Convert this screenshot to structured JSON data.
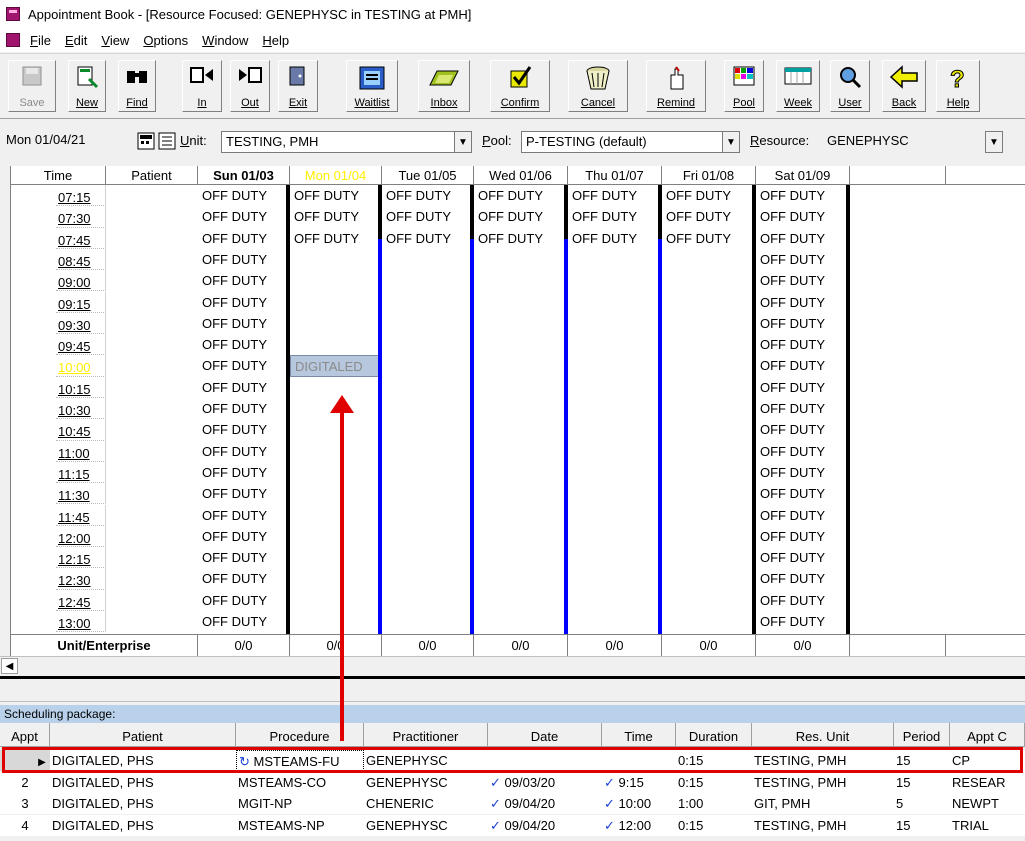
{
  "window": {
    "title": "Appointment Book - [Resource Focused:  GENEPHYSC in TESTING at PMH]"
  },
  "menu": [
    {
      "u": "F",
      "rest": "ile"
    },
    {
      "u": "E",
      "rest": "dit"
    },
    {
      "u": "V",
      "rest": "iew"
    },
    {
      "u": "O",
      "rest": "ptions"
    },
    {
      "u": "W",
      "rest": "indow"
    },
    {
      "u": "H",
      "rest": "elp"
    }
  ],
  "toolbar": {
    "save": "Save",
    "new": "New",
    "find": "Find",
    "in": "In",
    "out": "Out",
    "exit": "Exit",
    "waitlist": "Waitlist",
    "inbox": "Inbox",
    "confirm": "Confirm",
    "cancel": "Cancel",
    "remind": "Remind",
    "pool": "Pool",
    "week": "Week",
    "user": "User",
    "back": "Back",
    "help": "Help"
  },
  "filters": {
    "date": "Mon 01/04/21",
    "unit_label_u": "U",
    "unit_label_rest": "nit:",
    "unit_value": "TESTING, PMH",
    "pool_label_u": "P",
    "pool_label_rest": "ool:",
    "pool_value": "P-TESTING (default)",
    "resource_label_u": "R",
    "resource_label_rest": "esource:",
    "resource_value": "GENEPHYSC"
  },
  "grid": {
    "headers": {
      "time": "Time",
      "patient": "Patient",
      "sun": "Sun 01/03",
      "mon": "Mon 01/04",
      "tue": "Tue 01/05",
      "wed": "Wed 01/06",
      "thu": "Thu 01/07",
      "fri": "Fri 01/08",
      "sat": "Sat 01/09"
    },
    "off_duty": "OFF DUTY",
    "times": [
      "07:15",
      "07:30",
      "07:45",
      "08:45",
      "09:00",
      "09:15",
      "09:30",
      "09:45",
      "10:00",
      "10:15",
      "10:30",
      "10:45",
      "11:00",
      "11:15",
      "11:30",
      "11:45",
      "12:00",
      "12:15",
      "12:30",
      "12:45",
      "13:00"
    ],
    "selected_time": "10:00",
    "booked_cell": "DIGITALED",
    "footer": {
      "label": "Unit/Enterprise",
      "counts": [
        "0/0",
        "0/0",
        "0/0",
        "0/0",
        "0/0",
        "0/0",
        "0/0"
      ]
    }
  },
  "package": {
    "title": "Scheduling package:",
    "columns": [
      "Appt",
      "Patient",
      "Procedure",
      "Practitioner",
      "Date",
      "Time",
      "Duration",
      "Res. Unit",
      "Period",
      "Appt C"
    ],
    "rows": [
      {
        "appt": "",
        "patient": "DIGITALED, PHS",
        "procedure": "MSTEAMS-FU",
        "practitioner": "GENEPHYSC",
        "date": "",
        "time": "",
        "duration": "0:15",
        "res_unit": "TESTING, PMH",
        "period": "15",
        "appt_c": "CP"
      },
      {
        "appt": "2",
        "patient": "DIGITALED, PHS",
        "procedure": "MSTEAMS-CO",
        "practitioner": "GENEPHYSC",
        "date": "09/03/20",
        "time": "9:15",
        "duration": "0:15",
        "res_unit": "TESTING, PMH",
        "period": "15",
        "appt_c": "RESEAR"
      },
      {
        "appt": "3",
        "patient": "DIGITALED, PHS",
        "procedure": "MGIT-NP",
        "practitioner": "CHENERIC",
        "date": "09/04/20",
        "time": "10:00",
        "duration": "1:00",
        "res_unit": "GIT, PMH",
        "period": "5",
        "appt_c": "NEWPT"
      },
      {
        "appt": "4",
        "patient": "DIGITALED, PHS",
        "procedure": "MSTEAMS-NP",
        "practitioner": "GENEPHYSC",
        "date": "09/04/20",
        "time": "12:00",
        "duration": "0:15",
        "res_unit": "TESTING, PMH",
        "period": "15",
        "appt_c": "TRIAL"
      }
    ]
  }
}
